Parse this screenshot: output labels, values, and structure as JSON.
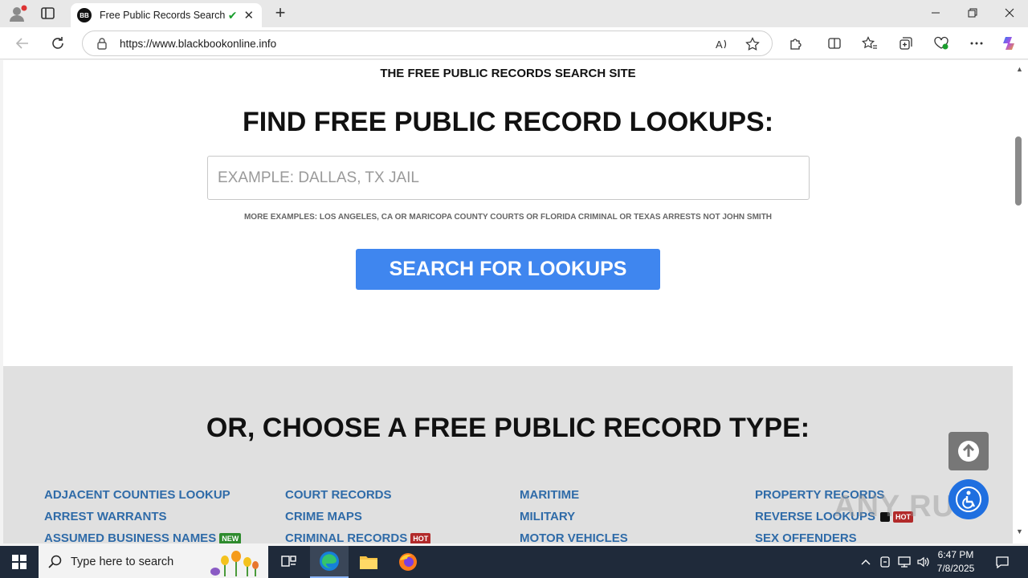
{
  "browser": {
    "tab_title": "Free Public Records Searches",
    "url_host": "https://www.blackbookonline.info",
    "favicon_text": "BB",
    "new_tab_label": "+",
    "close_tab_label": "✕"
  },
  "page": {
    "site_tag": "THE FREE PUBLIC RECORDS SEARCH SITE",
    "hero_title": "FIND FREE PUBLIC RECORD LOOKUPS:",
    "search_placeholder": "EXAMPLE: DALLAS, TX JAIL",
    "examples": "MORE EXAMPLES: LOS ANGELES, CA OR MARICOPA COUNTY COURTS OR FLORIDA CRIMINAL OR TEXAS ARRESTS NOT JOHN SMITH",
    "search_button": "SEARCH FOR LOOKUPS",
    "section_title": "OR, CHOOSE A FREE PUBLIC RECORD TYPE:",
    "record_links": {
      "col1": [
        "ADJACENT COUNTIES LOOKUP",
        "ARREST WARRANTS",
        "ASSUMED BUSINESS NAMES"
      ],
      "col2": [
        "COURT RECORDS",
        "CRIME MAPS",
        "CRIMINAL RECORDS"
      ],
      "col3": [
        "MARITIME",
        "MILITARY",
        "MOTOR VEHICLES"
      ],
      "col4": [
        "PROPERTY RECORDS",
        "REVERSE LOOKUPS",
        "SEX OFFENDERS"
      ]
    },
    "badge_new": "NEW",
    "badge_hot": "HOT",
    "watermark": "ANY RUN"
  },
  "taskbar": {
    "search_placeholder": "Type here to search",
    "time": "6:47 PM",
    "date": "7/8/2025"
  },
  "colors": {
    "link": "#2f6ba8",
    "search_button": "#3f86ef",
    "badge_new": "#2e8b2e",
    "badge_hot": "#b22a2a",
    "grey_section": "#e0e0e0"
  }
}
